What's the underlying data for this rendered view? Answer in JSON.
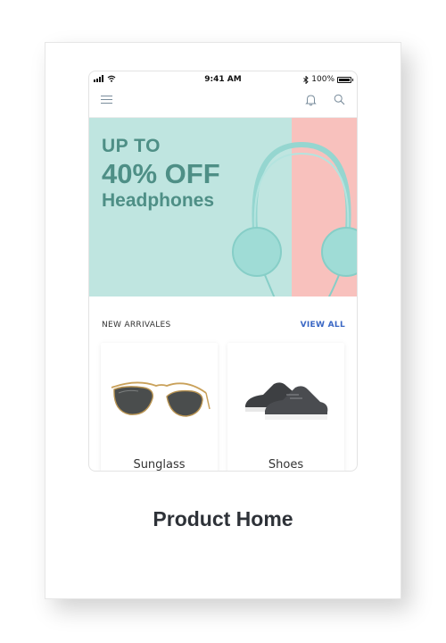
{
  "status_bar": {
    "time": "9:41 AM",
    "battery": "100%"
  },
  "navbar": {
    "icons": [
      "menu-icon",
      "bell-icon",
      "search-icon"
    ]
  },
  "banner": {
    "line1": "UP TO",
    "line2": "40% OFF",
    "line3": "Headphones",
    "colors": {
      "background": "#bfe5e0",
      "accent": "#f8c1bd",
      "text": "#4e8f86"
    }
  },
  "section": {
    "title": "NEW ARRIVALES",
    "view_all": "VIEW ALL"
  },
  "products": [
    {
      "name": "Sunglass",
      "image": "sunglasses"
    },
    {
      "name": "Shoes",
      "image": "sneakers"
    }
  ],
  "caption": "Product Home"
}
